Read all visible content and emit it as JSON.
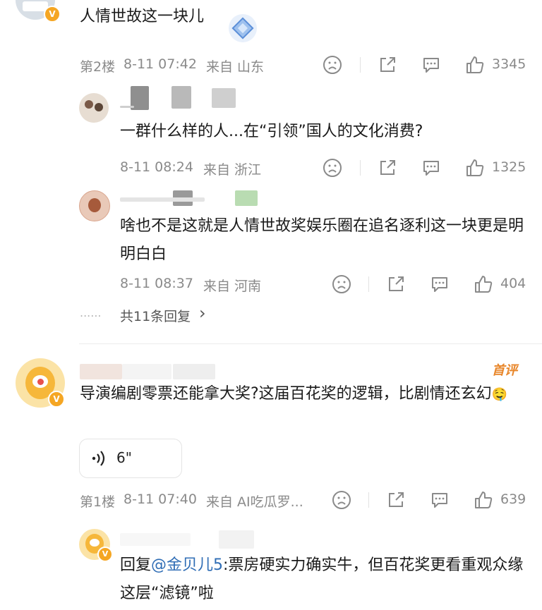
{
  "comment_top": {
    "text": "人情世故这一块儿",
    "floor": "第2楼",
    "time": "8-11 07:42",
    "location": "来自 山东",
    "likes": "3345",
    "verified_badge": "V"
  },
  "reply_1": {
    "text": "一群什么样的人...在“引领”国人的文化消费?",
    "time": "8-11 08:24",
    "location": "来自 浙江",
    "likes": "1325"
  },
  "reply_2": {
    "text": "啥也不是这就是人情世故奖娱乐圈在追名逐利这一块更是明明白白",
    "time": "8-11 08:37",
    "location": "来自 河南",
    "likes": "404"
  },
  "more_replies": {
    "dots": "......",
    "label": "共11条回复",
    "chevron": "›"
  },
  "comment_main": {
    "tag": "首评",
    "text": "导演编剧零票还能拿大奖?这届百花奖的逻辑，比剧情还玄幻",
    "emoji": "🤤",
    "voice_duration": "6\"",
    "floor": "第1楼",
    "time": "8-11 07:40",
    "location": "来自 AI吃瓜罗...",
    "likes": "639",
    "verified_badge": "V"
  },
  "reply_3": {
    "prefix": "回复",
    "mention": "@金贝儿5",
    "text": ":票房硬实力确实牛，但百花奖更看重观众缘这层“滤镜”啦",
    "verified_badge": "V"
  },
  "colors": {
    "meta_gray": "#8a8a8a",
    "link_blue": "#2f6db5",
    "tag_orange": "#e8862a",
    "badge_orange": "#f5a623"
  },
  "icons": [
    "sad-face-icon",
    "share-icon",
    "comment-icon",
    "thumbs-up-icon",
    "voice-wave-icon",
    "chevron-right-icon",
    "diamond-sticker-icon"
  ]
}
